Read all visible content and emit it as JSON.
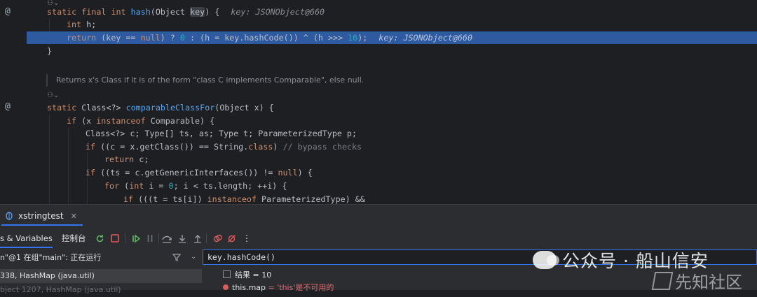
{
  "editor": {
    "lines": [
      {
        "kind": "hash_sig",
        "text": "static final int hash(Object key) {",
        "hint": "key: JSONObject@660"
      },
      {
        "kind": "plain",
        "text": "int h;"
      },
      {
        "kind": "hash_ret",
        "text": "return (key == null) ? 0 : (h = key.hashCode()) ^ (h >>> 16);",
        "hint": "key: JSONObject@660"
      },
      {
        "kind": "plain",
        "text": "}"
      },
      {
        "kind": "doc",
        "text": "Returns x's Class if it is of the form \"class C implements Comparable\", else null."
      },
      {
        "kind": "sig2",
        "text": "static Class<?> comparableClassFor(Object x) {"
      },
      {
        "kind": "if1",
        "text": "if (x instanceof Comparable) {"
      },
      {
        "kind": "decl",
        "text": "Class<?> c; Type[] ts, as; Type t; ParameterizedType p;"
      },
      {
        "kind": "if2",
        "text": "if ((c = x.getClass()) == String.class) // bypass checks"
      },
      {
        "kind": "ret",
        "text": "return c;"
      },
      {
        "kind": "if3",
        "text": "if ((ts = c.getGenericInterfaces()) != null) {"
      },
      {
        "kind": "for",
        "text": "for (int i = 0; i < ts.length; ++i) {"
      },
      {
        "kind": "if4",
        "text": "if (((t = ts[i]) instanceof ParameterizedType) &&"
      }
    ],
    "gutter_marks": [
      "@",
      "@"
    ],
    "inlay_icon": "author-hint-icon"
  },
  "debug": {
    "tab_label": "xstringtest",
    "tab_icon": "debug-icon",
    "subtab_threads": "s & Variables",
    "subtab_console": "控制台",
    "thread_text": "n\"@1 在组\"main\": 正在运行",
    "frames": [
      {
        "text": "338, HashMap (java.util)",
        "selected": true
      },
      {
        "text": "bject 1207, HashMap (java.util)",
        "selected": false
      }
    ],
    "eval_expression": "key.hashCode()",
    "result_label": "结果 = 10",
    "error_name": "this.map",
    "error_value": "= 'this'是不可用的"
  },
  "toolbar_icons": [
    "rerun-icon",
    "stop-icon",
    "resume-icon",
    "pause-icon",
    "step-over-icon",
    "step-into-icon",
    "step-out-icon",
    "view-breakpoints-icon",
    "mute-breakpoints-icon",
    "more-icon"
  ],
  "watermark": {
    "main": "公众号 · 船山信安",
    "secondary": "先知社区"
  },
  "colors": {
    "accent": "#3574f0",
    "highlight_line": "#2d5aa0",
    "keyword": "#cf8e6d",
    "function": "#56a8f5",
    "number": "#2aacb8"
  }
}
